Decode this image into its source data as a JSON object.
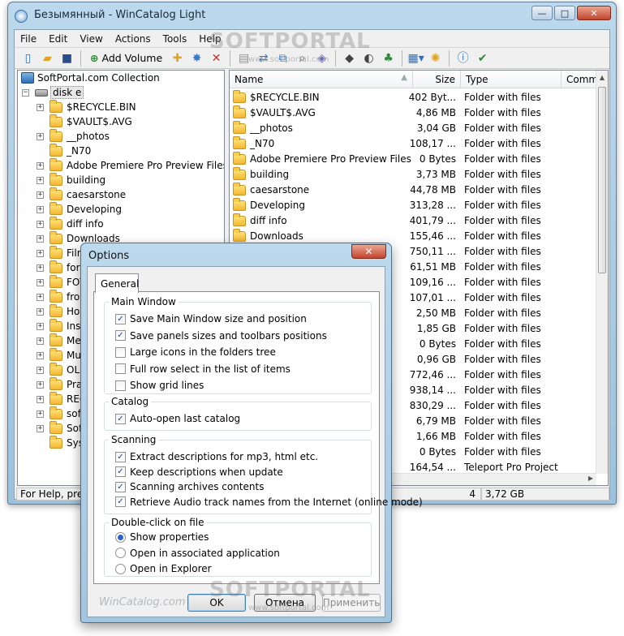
{
  "window": {
    "title": "Безымянный - WinCatalog Light",
    "minimize_glyph": "—",
    "maximize_glyph": "□",
    "close_glyph": "✕"
  },
  "menu": [
    "File",
    "Edit",
    "View",
    "Actions",
    "Tools",
    "Help"
  ],
  "toolbar": {
    "add_volume_label": "Add Volume"
  },
  "tree": {
    "collection": "SoftPortal.com Collection",
    "disk": "disk e",
    "items": [
      {
        "label": "$RECYCLE.BIN",
        "expander": "+"
      },
      {
        "label": "$VAULT$.AVG",
        "expander": ""
      },
      {
        "label": "__photos",
        "expander": "+"
      },
      {
        "label": "_N70",
        "expander": ""
      },
      {
        "label": "Adobe Premiere Pro Preview Files",
        "expander": "+"
      },
      {
        "label": "building",
        "expander": "+"
      },
      {
        "label": "caesarstone",
        "expander": "+"
      },
      {
        "label": "Developing",
        "expander": "+"
      },
      {
        "label": "diff info",
        "expander": "+"
      },
      {
        "label": "Downloads",
        "expander": "+"
      },
      {
        "label": "Film",
        "expander": "+"
      },
      {
        "label": "for",
        "expander": "+"
      },
      {
        "label": "FOT",
        "expander": "+"
      },
      {
        "label": "fron",
        "expander": "+"
      },
      {
        "label": "Hor",
        "expander": "+"
      },
      {
        "label": "Inst",
        "expander": "+"
      },
      {
        "label": "Me",
        "expander": "+"
      },
      {
        "label": "Mu",
        "expander": "+"
      },
      {
        "label": "OLD",
        "expander": "+"
      },
      {
        "label": "Pra",
        "expander": "+"
      },
      {
        "label": "REC",
        "expander": "+"
      },
      {
        "label": "soft",
        "expander": "+"
      },
      {
        "label": "Soft",
        "expander": "+"
      },
      {
        "label": "Sys",
        "expander": ""
      }
    ]
  },
  "list": {
    "columns": {
      "name": "Name",
      "size": "Size",
      "type": "Type",
      "comment": "Comme"
    },
    "rows": [
      {
        "name": "$RECYCLE.BIN",
        "size": "402 Byt...",
        "type": "Folder with files"
      },
      {
        "name": "$VAULT$.AVG",
        "size": "4,86 MB",
        "type": "Folder with files"
      },
      {
        "name": "__photos",
        "size": "3,04 GB",
        "type": "Folder with files"
      },
      {
        "name": "_N70",
        "size": "108,17 ...",
        "type": "Folder with files"
      },
      {
        "name": "Adobe Premiere Pro Preview Files",
        "size": "0 Bytes",
        "type": "Folder with files"
      },
      {
        "name": "building",
        "size": "3,73 MB",
        "type": "Folder with files"
      },
      {
        "name": "caesarstone",
        "size": "44,78 MB",
        "type": "Folder with files"
      },
      {
        "name": "Developing",
        "size": "313,28 ...",
        "type": "Folder with files"
      },
      {
        "name": "diff info",
        "size": "401,79 ...",
        "type": "Folder with files"
      },
      {
        "name": "Downloads",
        "size": "155,46 ...",
        "type": "Folder with files"
      },
      {
        "name": "Film",
        "size": "750,11 ...",
        "type": "Folder with files"
      },
      {
        "name": "for",
        "size": "61,51 MB",
        "type": "Folder with files"
      },
      {
        "name": "FOT",
        "size": "109,16 ...",
        "type": "Folder with files"
      },
      {
        "name": "fron",
        "size": "107,01 ...",
        "type": "Folder with files"
      },
      {
        "name": "Hor",
        "size": "2,50 MB",
        "type": "Folder with files"
      },
      {
        "name": "Inst",
        "size": "1,85 GB",
        "type": "Folder with files"
      },
      {
        "name": "Me",
        "size": "0 Bytes",
        "type": "Folder with files"
      },
      {
        "name": "Mu",
        "size": "0,96 GB",
        "type": "Folder with files"
      },
      {
        "name": "OLD",
        "size": "772,46 ...",
        "type": "Folder with files"
      },
      {
        "name": "Pra",
        "size": "938,14 ...",
        "type": "Folder with files"
      },
      {
        "name": "REC",
        "size": "830,29 ...",
        "type": "Folder with files"
      },
      {
        "name": "soft",
        "size": "6,79 MB",
        "type": "Folder with files"
      },
      {
        "name": "Soft",
        "size": "1,66 MB",
        "type": "Folder with files"
      },
      {
        "name": "Sys",
        "size": "0 Bytes",
        "type": "Folder with files"
      },
      {
        "name": "",
        "size": "164,54 ...",
        "type": "Teleport Pro Project"
      }
    ]
  },
  "status": {
    "left": "For Help, press",
    "middle": "4",
    "right": "3,72 GB"
  },
  "dialog": {
    "title": "Options",
    "close_glyph": "✕",
    "tab": "General",
    "groups": {
      "main_window": {
        "title": "Main Window",
        "options": [
          {
            "label": "Save Main Window size and position",
            "checked": true
          },
          {
            "label": "Save panels sizes and toolbars positions",
            "checked": true
          },
          {
            "label": "Large icons in the folders tree",
            "checked": false
          },
          {
            "label": "Full row select in the list of items",
            "checked": false
          },
          {
            "label": "Show grid lines",
            "checked": false
          }
        ]
      },
      "catalog": {
        "title": "Catalog",
        "options": [
          {
            "label": "Auto-open last catalog",
            "checked": true
          }
        ]
      },
      "scanning": {
        "title": "Scanning",
        "options": [
          {
            "label": "Extract descriptions for mp3, html etc.",
            "checked": true
          },
          {
            "label": "Keep descriptions when update",
            "checked": true
          },
          {
            "label": "Scanning archives contents",
            "checked": true
          },
          {
            "label": "Retrieve Audio track names from the Internet (online mode)",
            "checked": true
          }
        ]
      },
      "double_click": {
        "title": "Double-click on file",
        "options": [
          {
            "label": "Show properties",
            "selected": true
          },
          {
            "label": "Open in associated application",
            "selected": false
          },
          {
            "label": "Open in Explorer",
            "selected": false
          }
        ]
      }
    },
    "footer_logo": "WinCatalog.com",
    "ok": "OK",
    "cancel": "Отмена",
    "apply": "Применить"
  },
  "watermark": {
    "text": "SOFTPORTAL",
    "sub": "www.softportal.com"
  },
  "colors": {
    "accent": "#2b62c4",
    "folder": "#f4b72f",
    "title_bar": "#bcd8ec"
  }
}
